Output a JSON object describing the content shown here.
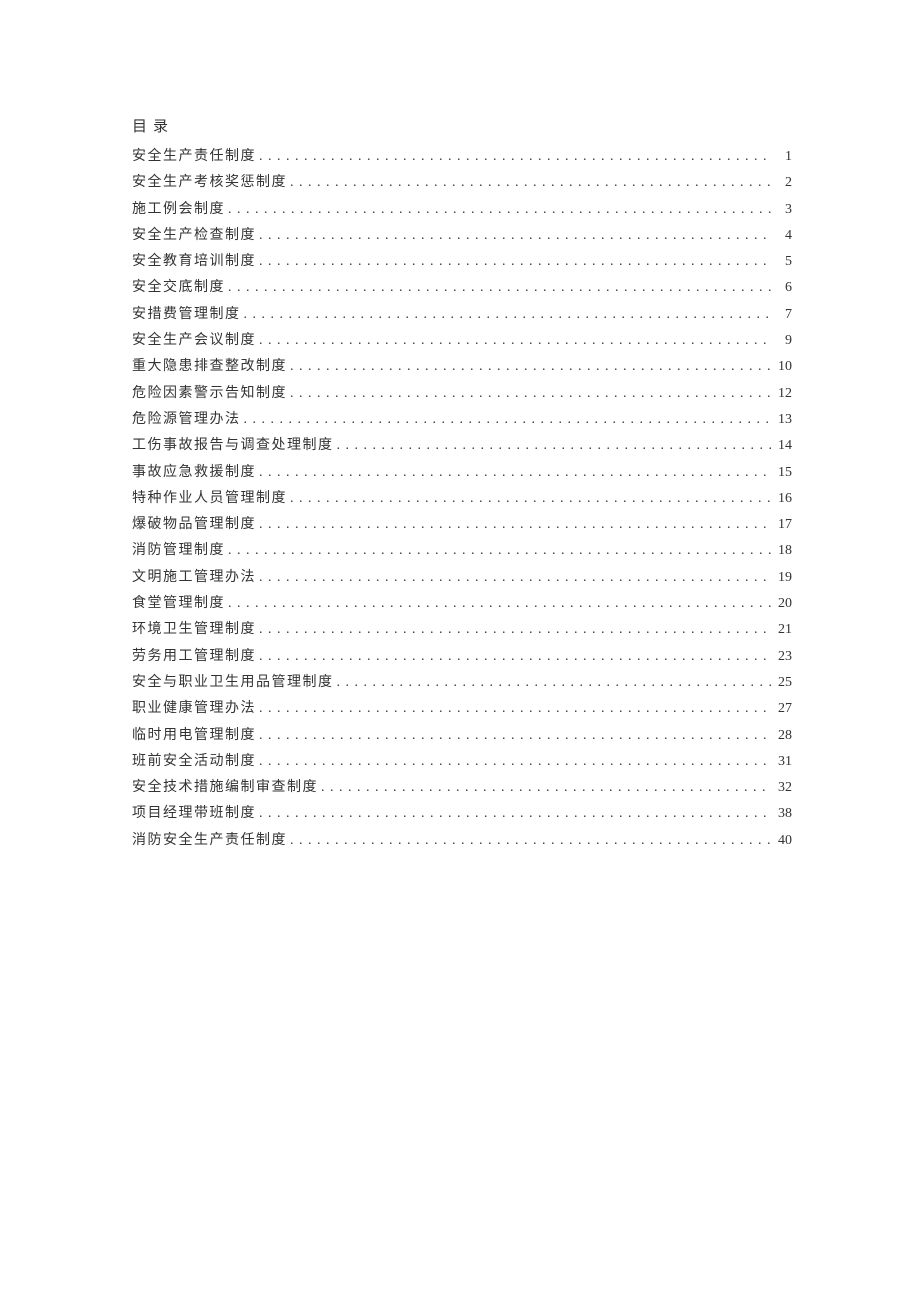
{
  "heading": "目录",
  "entries": [
    {
      "title": "安全生产责任制度",
      "page": "1"
    },
    {
      "title": "安全生产考核奖惩制度",
      "page": "2"
    },
    {
      "title": "施工例会制度",
      "page": "3"
    },
    {
      "title": "安全生产检查制度",
      "page": "4"
    },
    {
      "title": "安全教育培训制度",
      "page": "5"
    },
    {
      "title": "安全交底制度",
      "page": "6"
    },
    {
      "title": "安措费管理制度",
      "page": "7"
    },
    {
      "title": "安全生产会议制度",
      "page": "9"
    },
    {
      "title": "重大隐患排查整改制度",
      "page": "10"
    },
    {
      "title": "危险因素警示告知制度",
      "page": "12"
    },
    {
      "title": "危险源管理办法",
      "page": "13"
    },
    {
      "title": "工伤事故报告与调查处理制度",
      "page": "14"
    },
    {
      "title": "事故应急救援制度",
      "page": "15"
    },
    {
      "title": "特种作业人员管理制度",
      "page": "16"
    },
    {
      "title": "爆破物品管理制度",
      "page": "17"
    },
    {
      "title": "消防管理制度",
      "page": "18"
    },
    {
      "title": "文明施工管理办法",
      "page": "19"
    },
    {
      "title": "食堂管理制度",
      "page": "20"
    },
    {
      "title": "环境卫生管理制度",
      "page": "21"
    },
    {
      "title": "劳务用工管理制度",
      "page": "23"
    },
    {
      "title": "安全与职业卫生用品管理制度",
      "page": "25"
    },
    {
      "title": "职业健康管理办法",
      "page": "27"
    },
    {
      "title": "临时用电管理制度",
      "page": "28"
    },
    {
      "title": "班前安全活动制度",
      "page": "31"
    },
    {
      "title": "安全技术措施编制审查制度",
      "page": "32"
    },
    {
      "title": "项目经理带班制度",
      "page": "38"
    },
    {
      "title": "消防安全生产责任制度",
      "page": "40"
    }
  ]
}
